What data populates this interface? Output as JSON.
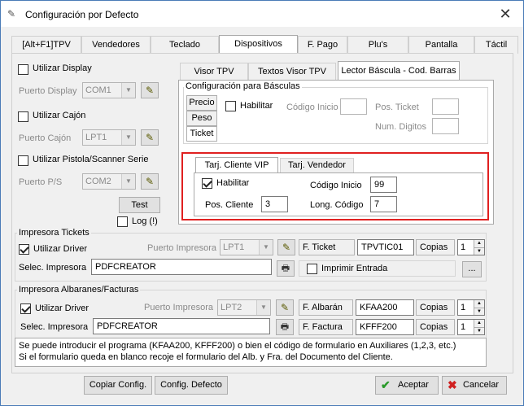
{
  "window": {
    "title": "Configuración por Defecto"
  },
  "main_tabs": [
    "[Alt+F1]TPV",
    "Vendedores",
    "Teclado",
    "Dispositivos",
    "F. Pago",
    "Plu's",
    "Pantalla",
    "Táctil"
  ],
  "left": {
    "display_cb": "Utilizar Display",
    "puerto_display_lbl": "Puerto Display",
    "puerto_display_val": "COM1",
    "cajon_cb": "Utilizar Cajón",
    "puerto_cajon_lbl": "Puerto Cajón",
    "puerto_cajon_val": "LPT1",
    "pistola_cb": "Utilizar Pistola/Scanner Serie",
    "puerto_ps_lbl": "Puerto P/S",
    "puerto_ps_val": "COM2",
    "test_btn": "Test",
    "log_cb": "Log (!)"
  },
  "sub_tabs": [
    "Visor TPV",
    "Textos Visor TPV",
    "Lector Báscula - Cod. Barras"
  ],
  "basculas": {
    "title": "Configuración para Básculas",
    "side": [
      "Precio",
      "Peso",
      "Ticket"
    ],
    "habilitar": "Habilitar",
    "codigo_inicio": "Código Inicio",
    "pos_ticket": "Pos. Ticket",
    "num_digitos": "Num. Digitos"
  },
  "cliente_tabs": [
    "Tarj. Cliente VIP",
    "Tarj. Vendedor"
  ],
  "cliente": {
    "habilitar": "Habilitar",
    "codigo_inicio_lbl": "Código Inicio",
    "codigo_inicio_val": "99",
    "pos_cliente_lbl": "Pos. Cliente",
    "pos_cliente_val": "3",
    "long_codigo_lbl": "Long. Código",
    "long_codigo_val": "7"
  },
  "tickets": {
    "title": "Impresora Tickets",
    "driver_cb": "Utilizar Driver",
    "puerto_lbl": "Puerto Impresora",
    "puerto_val": "LPT1",
    "fticket_lbl": "F. Ticket",
    "fticket_val": "TPVTIC01",
    "copias_lbl": "Copias",
    "copias_val": "1",
    "selec_lbl": "Selec. Impresora",
    "selec_val": "PDFCREATOR",
    "imprimir_entrada": "Imprimir Entrada",
    "more_btn": "..."
  },
  "albaranes": {
    "title": "Impresora Albaranes/Facturas",
    "driver_cb": "Utilizar Driver",
    "puerto_lbl": "Puerto Impresora",
    "puerto_val": "LPT2",
    "falbaran_lbl": "F. Albarán",
    "falbaran_val": "KFAA200",
    "ffactura_lbl": "F. Factura",
    "ffactura_val": "KFFF200",
    "copias_lbl": "Copias",
    "copias1_val": "1",
    "copias2_val": "1",
    "selec_lbl": "Selec. Impresora",
    "selec_val": "PDFCREATOR"
  },
  "info": {
    "line1": "Se puede introducir el programa (KFAA200, KFFF200) o bien el código de formulario en Auxiliares (1,2,3, etc.)",
    "line2": "Si el formulario queda en blanco recoje el formulario del Alb. y Fra. del Documento del Cliente."
  },
  "footer": {
    "copiar": "Copiar Config.",
    "defecto": "Config. Defecto",
    "aceptar": "Aceptar",
    "cancelar": "Cancelar"
  }
}
